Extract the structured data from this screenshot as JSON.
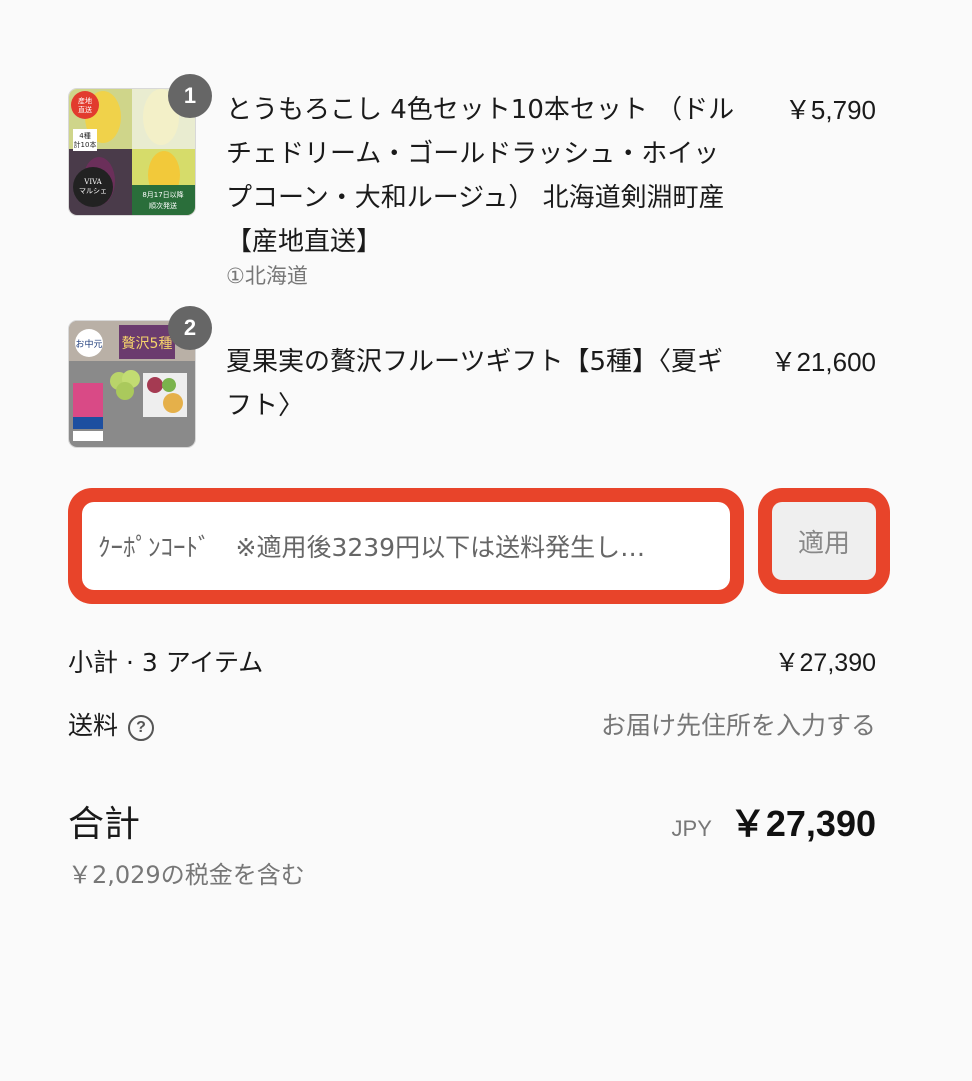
{
  "cart": {
    "items": [
      {
        "quantity": "1",
        "title": "とうもろこし 4色セット10本セット （ドルチェドリーム・ゴールドラッシュ・ホイップコーン・大和ルージュ） 北海道剣淵町産【産地直送】",
        "variant": "①北海道",
        "price": "￥5,790",
        "thumb_text": {
          "badge": "産地\n直送",
          "count": "4種\n計10本",
          "brand": "VIVA\nマルシェ",
          "note": "8月17日以降\n順次発送"
        }
      },
      {
        "quantity": "2",
        "title": "夏果実の贅沢フルーツギフト【5種】〈夏ギフト〉",
        "price": "￥21,600",
        "thumb_text": {
          "tag": "お中元",
          "banner": "贅沢5種"
        }
      }
    ]
  },
  "coupon": {
    "placeholder": "ｸｰﾎﾟﾝｺｰﾄﾞ　※適用後3239円以下は送料発生し…",
    "apply_label": "適用"
  },
  "summary": {
    "subtotal_label": "小計 · 3 アイテム",
    "subtotal_value": "￥27,390",
    "shipping_label": "送料",
    "shipping_value": "お届け先住所を入力する",
    "total_label": "合計",
    "currency": "JPY",
    "total_value": "￥27,390",
    "tax_note": "￥2,029の税金を含む"
  },
  "colors": {
    "highlight": "#e8442a",
    "badge": "#666666",
    "muted": "#777777"
  }
}
